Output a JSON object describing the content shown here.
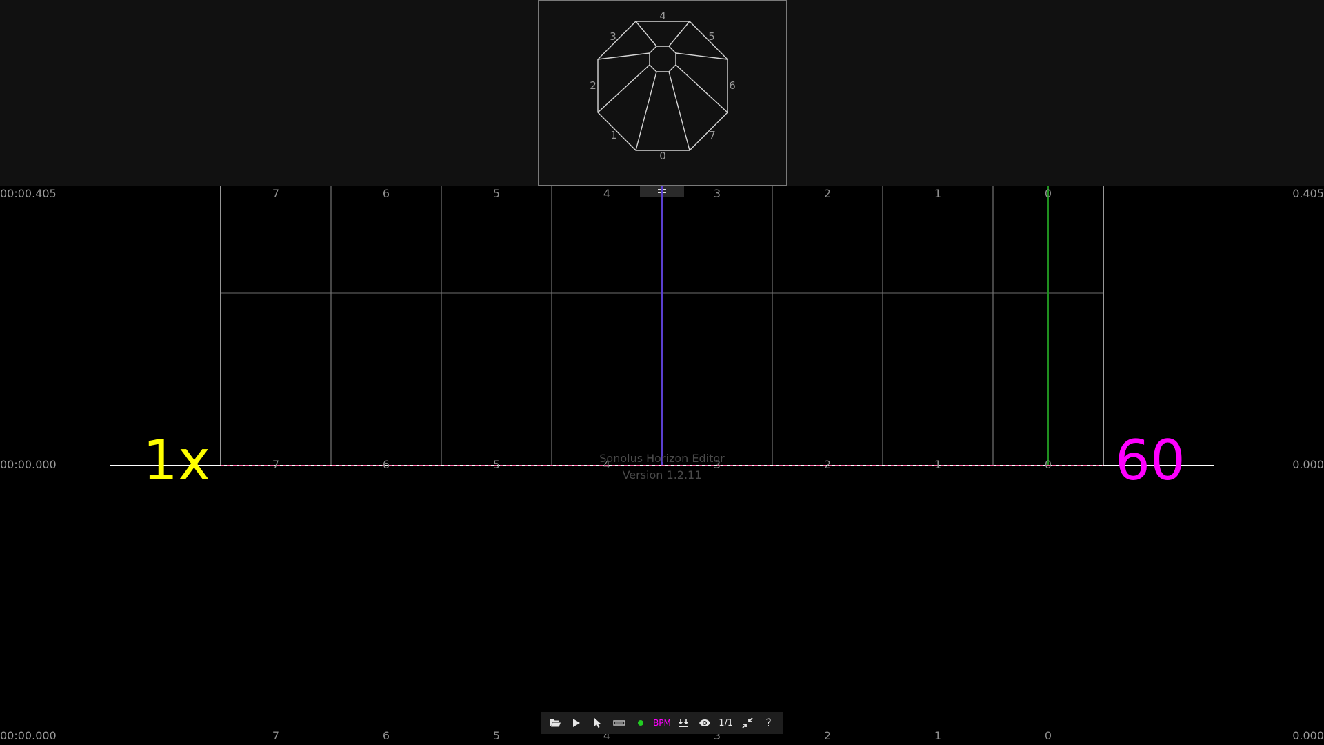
{
  "app": {
    "name": "Sonolus Horizon Editor",
    "version": "Version 1.2.11"
  },
  "preview": {
    "lane_labels": [
      "0",
      "1",
      "2",
      "3",
      "4",
      "5",
      "6",
      "7"
    ]
  },
  "timeline": {
    "top_left_time": "00:00.405",
    "top_right_value": "0.405",
    "mid_left_time": "00:00.000",
    "mid_right_value": "0.000",
    "bottom_left_time": "00:00.000",
    "bottom_right_value": "0.000",
    "lane_labels_left_to_right": [
      "7",
      "6",
      "5",
      "4",
      "3",
      "2",
      "1",
      "0"
    ],
    "speed_multiplier": "1x",
    "bpm_value": "60"
  },
  "toolbar": {
    "items": [
      {
        "name": "open-icon"
      },
      {
        "name": "play-icon"
      },
      {
        "name": "select-cursor-icon"
      },
      {
        "name": "note-tool-icon"
      },
      {
        "name": "status-dot-icon",
        "color": "#22cc22"
      },
      {
        "name": "bpm-tool",
        "label": "BPM",
        "color": "#ff00ff"
      },
      {
        "name": "snap-down-icon"
      },
      {
        "name": "eye-icon"
      },
      {
        "name": "division",
        "label": "1/1"
      },
      {
        "name": "collapse-icon"
      },
      {
        "name": "help",
        "label": "?"
      }
    ]
  },
  "colors": {
    "speed": "#ffff00",
    "bpm": "#ff00ff",
    "judgment_line": "#ffffff",
    "center_line": "#5a3fd0",
    "lane0_line": "#1f8f1f",
    "dashed_line": "#ff3a8a"
  }
}
